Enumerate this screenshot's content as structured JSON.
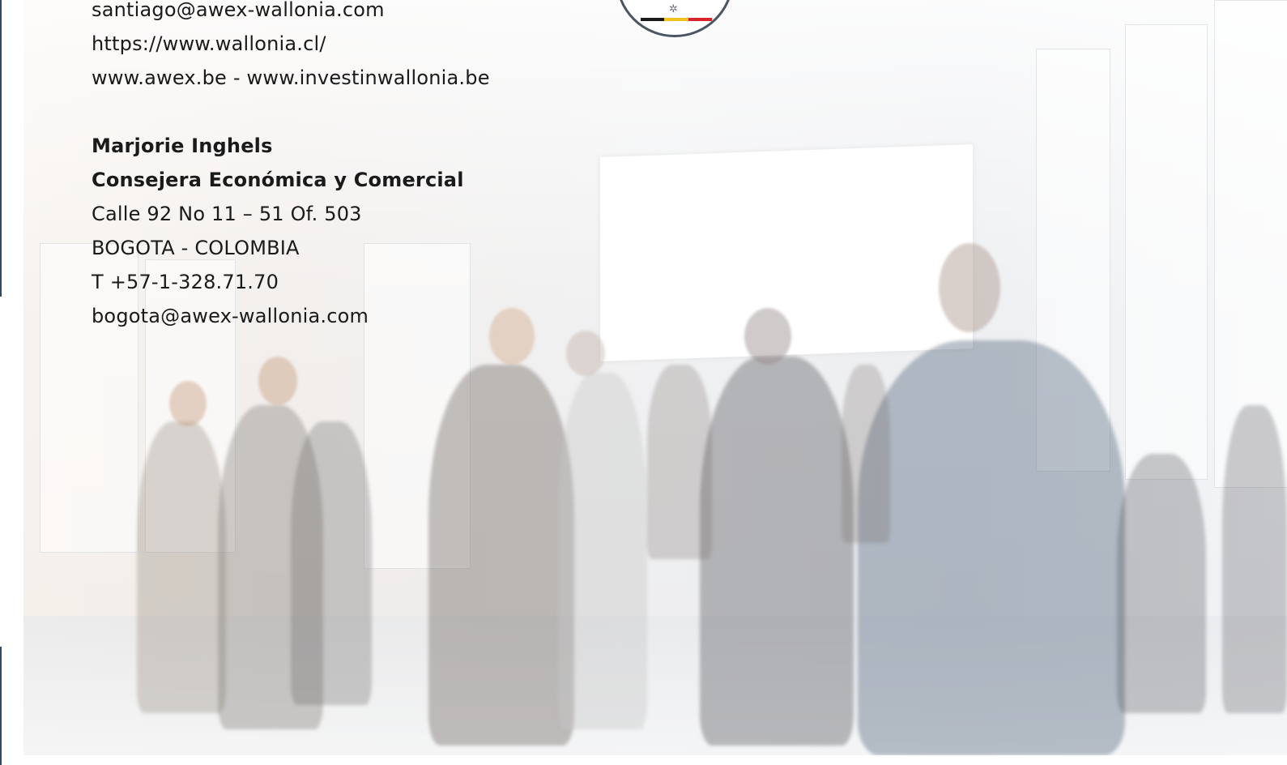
{
  "colors": {
    "edge": "#2d4a66",
    "text": "#1a1a1a",
    "flag_black": "#1a1a1a",
    "flag_yellow": "#f2c31d",
    "flag_red": "#d6262b",
    "emblem_border": "#4a5563"
  },
  "emblem": {
    "icon": "belgium-emblem-icon"
  },
  "contact_previous": {
    "email": "santiago@awex-wallonia.com",
    "website": "https://www.wallonia.cl/",
    "websites_extra": "www.awex.be - www.investinwallonia.be"
  },
  "contact_bogota": {
    "name": "Marjorie Inghels",
    "role": "Consejera Económica y Comercial",
    "address": "Calle 92 No 11 – 51 Of. 503",
    "city": "BOGOTA - COLOMBIA",
    "phone": "T +57-1-328.71.70",
    "email": "bogota@awex-wallonia.com"
  }
}
